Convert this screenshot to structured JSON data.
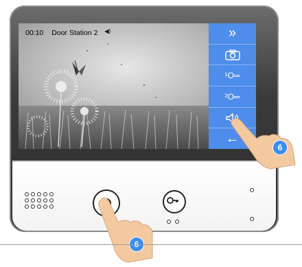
{
  "status": {
    "time": "00:10",
    "station": "Door Station 2",
    "volume_icon": "speaker-small-icon"
  },
  "menu": [
    {
      "icon": "fast-forward-icon",
      "glyph": "»"
    },
    {
      "icon": "camera-icon",
      "glyph": ""
    },
    {
      "icon": "unlock-1-icon",
      "glyph": "¹O═"
    },
    {
      "icon": "unlock-2-icon",
      "glyph": "²O═"
    },
    {
      "icon": "volume-icon",
      "glyph": ""
    },
    {
      "icon": "back-arrow-icon",
      "glyph": "←"
    }
  ],
  "badges": {
    "screen_hand": "6",
    "button_hand": "6"
  },
  "colors": {
    "menu_blue": "#4f8dea",
    "badge_blue": "#3a8ef2",
    "bezel": "#3b3b3b"
  }
}
